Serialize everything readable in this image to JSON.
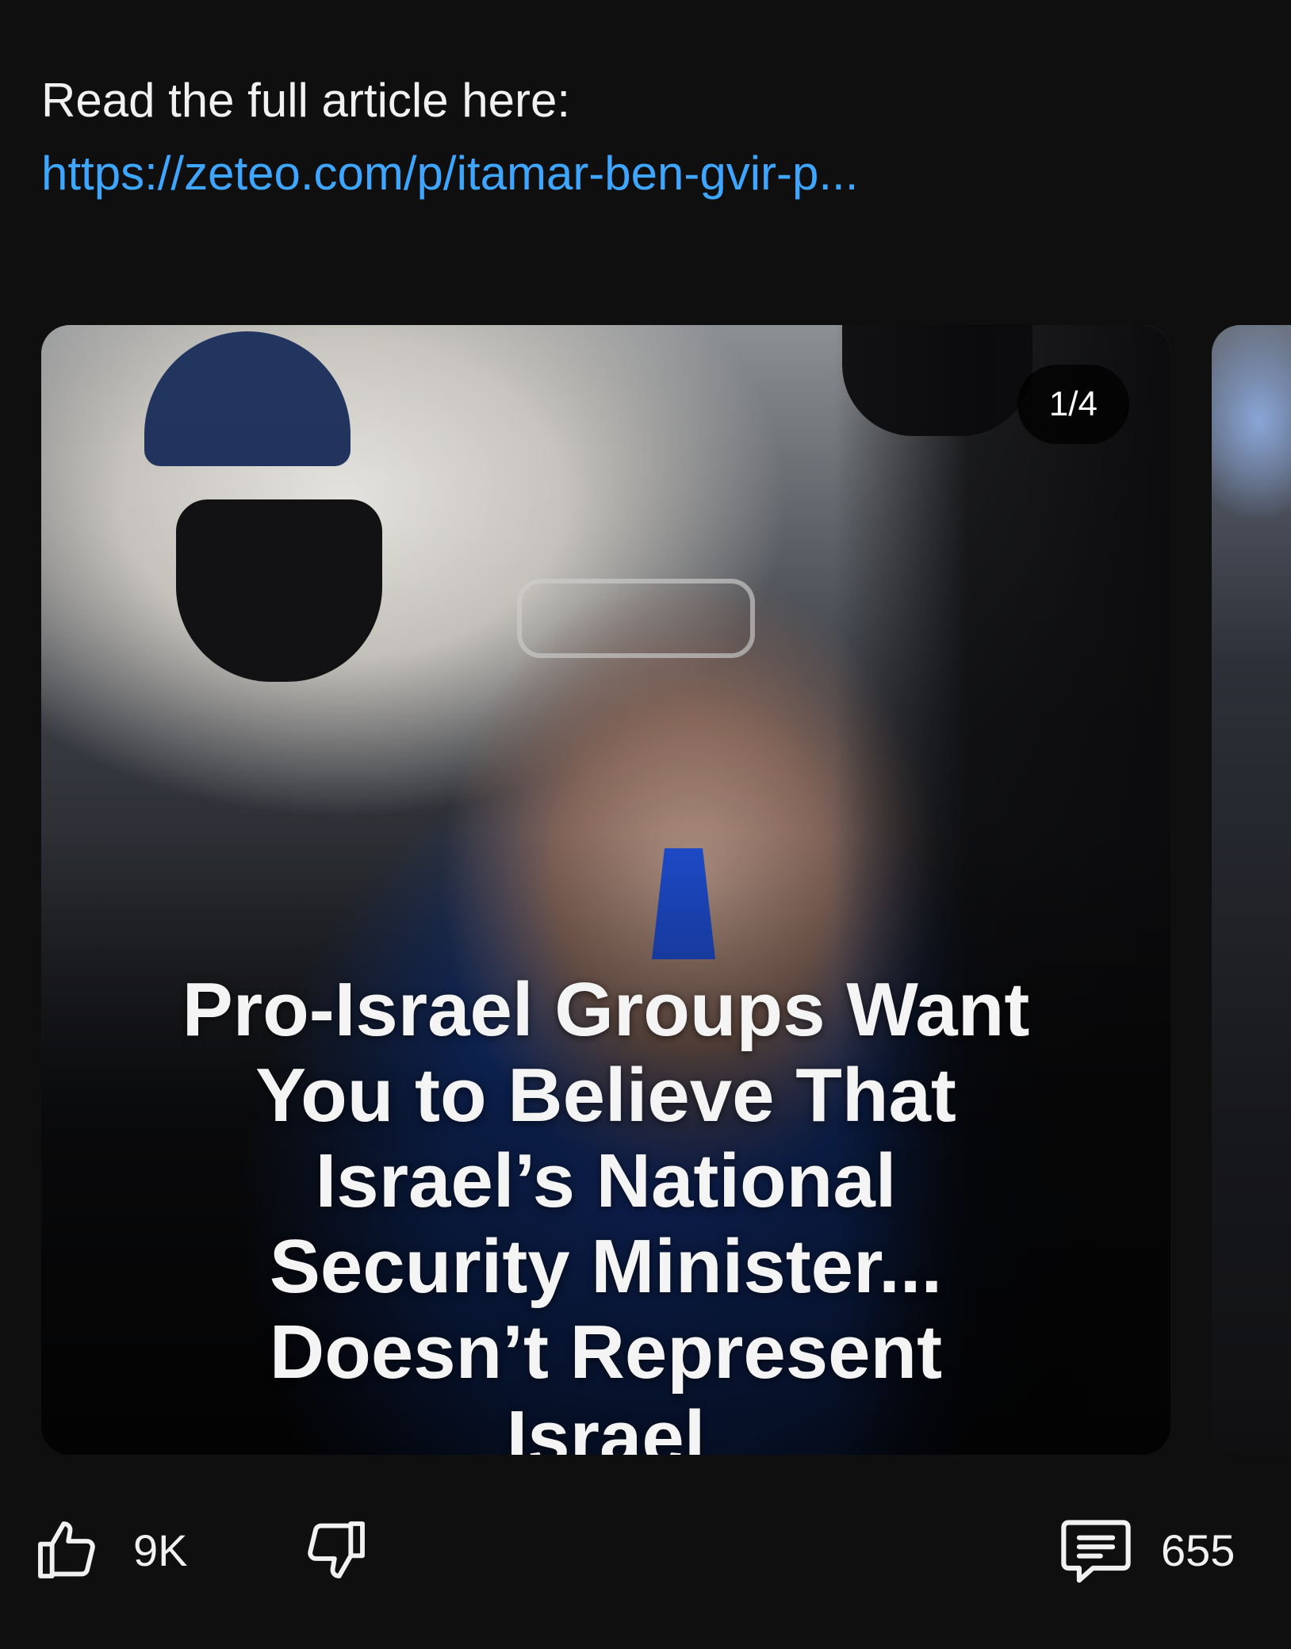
{
  "post": {
    "intro_text": "Read the full article here:",
    "link_text": "https://zeteo.com/p/itamar-ben-gvir-p..."
  },
  "carousel": {
    "counter": "1/4",
    "headline_lines": [
      "Pro-Israel Groups Want",
      "You to Believe That",
      "Israel’s National",
      "Security Minister...",
      "Doesn’t Represent",
      "Israel"
    ]
  },
  "actions": {
    "like_icon": "thumb-up-icon",
    "like_count": "9K",
    "dislike_icon": "thumb-down-icon",
    "comment_icon": "comment-icon",
    "comment_count": "655"
  },
  "colors": {
    "background": "#0f0f0f",
    "link": "#3ea6ff",
    "text": "#f1f1f1"
  }
}
